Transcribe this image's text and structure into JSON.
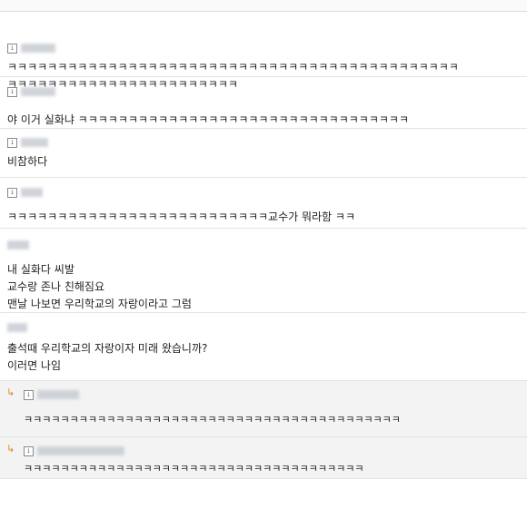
{
  "comments": [
    {
      "icon": "info-icon",
      "text": "ㅋㅋㅋㅋㅋㅋㅋㅋㅋㅋㅋㅋㅋㅋㅋㅋㅋㅋㅋㅋㅋㅋㅋㅋㅋㅋㅋㅋㅋㅋㅋㅋㅋㅋㅋㅋㅋㅋㅋㅋㅋㅋㅋㅋㅋ\nㅋㅋㅋㅋㅋㅋㅋㅋㅋㅋㅋㅋㅋㅋㅋㅋㅋㅋㅋㅋㅋㅋㅋ"
    },
    {
      "icon": "info-icon",
      "text": "야 이거 실화냐 ㅋㅋㅋㅋㅋㅋㅋㅋㅋㅋㅋㅋㅋㅋㅋㅋㅋㅋㅋㅋㅋㅋㅋㅋㅋㅋㅋㅋㅋㅋㅋㅋㅋ"
    },
    {
      "icon": "info-icon",
      "text": "비참하다"
    },
    {
      "icon": "info-icon",
      "text": "ㅋㅋㅋㅋㅋㅋㅋㅋㅋㅋㅋㅋㅋㅋㅋㅋㅋㅋㅋㅋㅋㅋㅋㅋㅋㅋ교수가 뭐라함 ㅋㅋ"
    },
    {
      "icon": "",
      "text": "내 실화다 씨발\n교수랑 존나 친해짐요\n맨날 나보면 우리학교의 자랑이라고 그럼"
    },
    {
      "icon": "",
      "text": "출석때 우리학교의 자랑이자 미래 왔습니까?\n이러면 나임"
    }
  ],
  "replies": [
    {
      "arrow": "↳",
      "icon": "info-icon",
      "text": "ㅋㅋㅋㅋㅋㅋㅋㅋㅋㅋㅋㅋㅋㅋㅋㅋㅋㅋㅋㅋㅋㅋㅋㅋㅋㅋㅋㅋㅋㅋㅋㅋㅋㅋㅋㅋㅋㅋㅋㅋㅋ"
    },
    {
      "arrow": "↳",
      "icon": "info-icon",
      "text": "ㅋㅋㅋㅋㅋㅋㅋㅋㅋㅋㅋㅋㅋㅋㅋㅋㅋㅋㅋㅋㅋㅋㅋㅋㅋㅋㅋㅋㅋㅋㅋㅋㅋㅋㅋㅋㅋ"
    }
  ]
}
